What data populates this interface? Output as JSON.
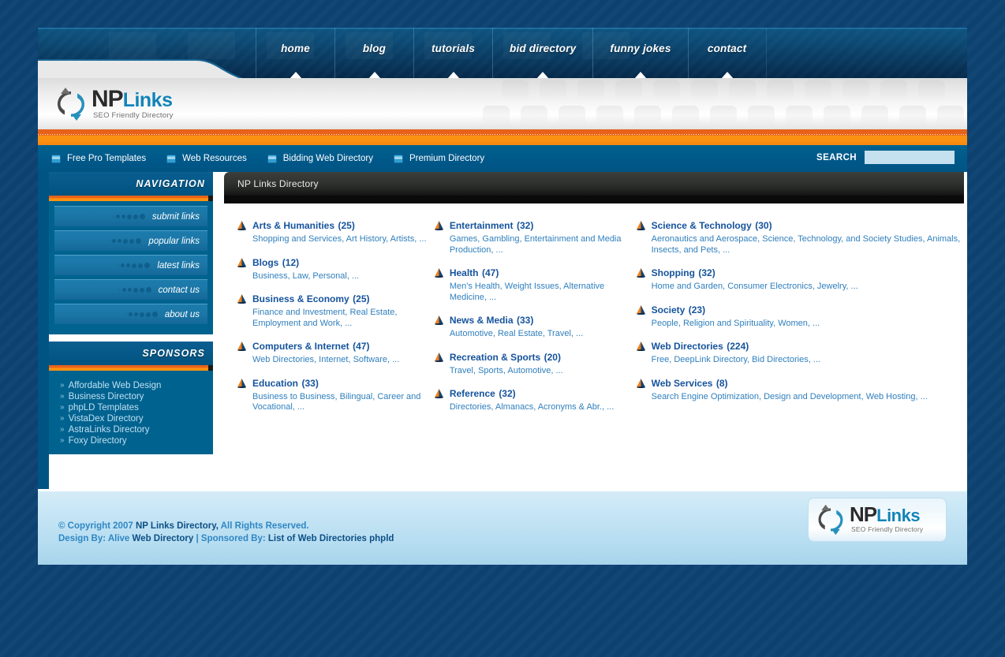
{
  "colors": {
    "page_bg": "#0c4272",
    "header_blue": "#0a3c63",
    "accent_orange": "#fb9111",
    "accent_orange_dark": "#e8621b",
    "sub_bar": "#005483",
    "link_blue": "#15539c",
    "sub_link_blue": "#2f7fbd",
    "footer_bg": "#c6e5f5"
  },
  "brand": {
    "name_part1": "NP",
    "name_part2": "Links",
    "tagline": "SEO Friendly Directory"
  },
  "topnav": {
    "items": [
      {
        "label": "home"
      },
      {
        "label": "blog"
      },
      {
        "label": "tutorials"
      },
      {
        "label": "bid directory"
      },
      {
        "label": "funny jokes"
      },
      {
        "label": "contact"
      }
    ]
  },
  "subbar": {
    "links": [
      {
        "label": "Free Pro Templates"
      },
      {
        "label": "Web Resources"
      },
      {
        "label": "Bidding Web Directory"
      },
      {
        "label": "Premium Directory"
      }
    ],
    "search_label": "SEARCH",
    "search_value": "",
    "search_placeholder": ""
  },
  "sidebar": {
    "navigation": {
      "title": "NAVIGATION",
      "items": [
        {
          "label": "submit links"
        },
        {
          "label": "popular links"
        },
        {
          "label": "latest links"
        },
        {
          "label": "contact us"
        },
        {
          "label": "about us"
        }
      ]
    },
    "sponsors": {
      "title": "SPONSORS",
      "items": [
        {
          "label": "Affordable Web Design"
        },
        {
          "label": "Business Directory"
        },
        {
          "label": "phpLD Templates"
        },
        {
          "label": "VistaDex Directory"
        },
        {
          "label": "AstraLinks Directory"
        },
        {
          "label": "Foxy Directory"
        }
      ]
    }
  },
  "content": {
    "title": "NP Links Directory",
    "columns": [
      {
        "categories": [
          {
            "name": "Arts & Humanities",
            "count": "(25)",
            "sub": "Shopping and Services, Art History, Artists, ..."
          },
          {
            "name": "Blogs",
            "count": "(12)",
            "sub": "Business, Law, Personal, ..."
          },
          {
            "name": "Business & Economy",
            "count": "(25)",
            "sub": "Finance and Investment, Real Estate, Employment and Work, ..."
          },
          {
            "name": "Computers & Internet",
            "count": "(47)",
            "sub": "Web Directories, Internet, Software, ..."
          },
          {
            "name": "Education",
            "count": "(33)",
            "sub": "Business to Business, Bilingual, Career and Vocational, ..."
          }
        ]
      },
      {
        "categories": [
          {
            "name": "Entertainment",
            "count": "(32)",
            "sub": "Games, Gambling, Entertainment and Media Production, ..."
          },
          {
            "name": "Health",
            "count": "(47)",
            "sub": "Men's Health, Weight Issues, Alternative Medicine, ..."
          },
          {
            "name": "News & Media",
            "count": "(33)",
            "sub": "Automotive, Real Estate, Travel, ..."
          },
          {
            "name": "Recreation & Sports",
            "count": "(20)",
            "sub": "Travel, Sports, Automotive, ..."
          },
          {
            "name": "Reference",
            "count": "(32)",
            "sub": "Directories, Almanacs, Acronyms & Abr., ..."
          }
        ]
      },
      {
        "categories": [
          {
            "name": "Science & Technology",
            "count": "(30)",
            "sub": "Aeronautics and Aerospace, Science, Technology, and Society Studies, Animals, Insects, and Pets, ..."
          },
          {
            "name": "Shopping",
            "count": "(32)",
            "sub": "Home and Garden, Consumer Electronics, Jewelry, ..."
          },
          {
            "name": "Society",
            "count": "(23)",
            "sub": "People, Religion and Spirituality, Women, ..."
          },
          {
            "name": "Web Directories",
            "count": "(224)",
            "sub": "Free, DeepLink Directory, Bid Directories, ..."
          },
          {
            "name": "Web Services",
            "count": "(8)",
            "sub": "Search Engine Optimization, Design and Development, Web Hosting, ..."
          }
        ]
      }
    ]
  },
  "footer": {
    "line1_a": "© Copyright 2007 ",
    "line1_b": "NP Links Directory,",
    "line1_c": " All Rights Reserved.",
    "line2_a": "Design By: Alive ",
    "line2_b": "Web Directory",
    "line2_c": " | ",
    "line2_d": "Sponsored By: ",
    "line2_e": "List of Web Directories phpld"
  }
}
